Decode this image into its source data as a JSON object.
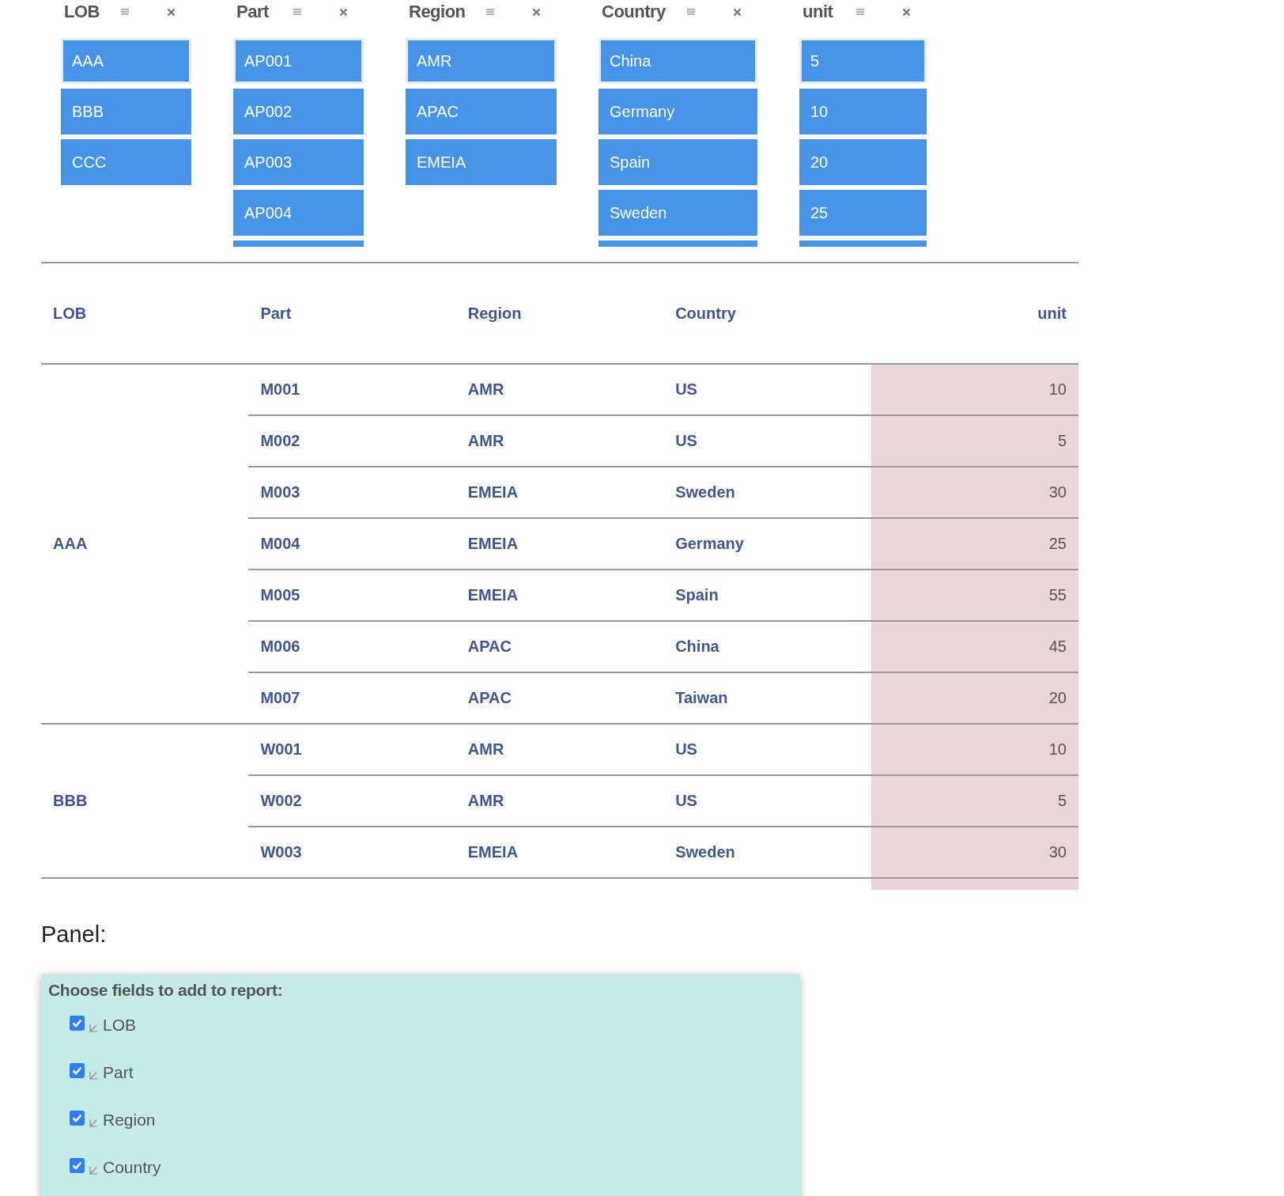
{
  "slicers": [
    {
      "title": "LOB",
      "items": [
        {
          "label": "AAA",
          "selected": true
        },
        {
          "label": "BBB",
          "selected": true
        },
        {
          "label": "CCC",
          "selected": true
        }
      ]
    },
    {
      "title": "Part",
      "more_below": true,
      "items": [
        {
          "label": "AP001",
          "selected": true
        },
        {
          "label": "AP002",
          "selected": true
        },
        {
          "label": "AP003",
          "selected": true
        },
        {
          "label": "AP004",
          "selected": true
        }
      ]
    },
    {
      "title": "Region",
      "items": [
        {
          "label": "AMR",
          "selected": true
        },
        {
          "label": "APAC",
          "selected": true
        },
        {
          "label": "EMEIA",
          "selected": true
        }
      ]
    },
    {
      "title": "Country",
      "more_below": true,
      "items": [
        {
          "label": "China",
          "selected": true
        },
        {
          "label": "Germany",
          "selected": true
        },
        {
          "label": "Spain",
          "selected": true
        },
        {
          "label": "Sweden",
          "selected": true
        }
      ]
    },
    {
      "title": "unit",
      "more_below": true,
      "items": [
        {
          "label": "5",
          "selected": true
        },
        {
          "label": "10",
          "selected": true
        },
        {
          "label": "20",
          "selected": true
        },
        {
          "label": "25",
          "selected": true
        }
      ]
    }
  ],
  "table": {
    "columns": [
      "LOB",
      "Part",
      "Region",
      "Country",
      "unit"
    ],
    "groups": [
      {
        "lob": "AAA",
        "rows": [
          {
            "part": "M001",
            "region": "AMR",
            "country": "US",
            "unit": "10"
          },
          {
            "part": "M002",
            "region": "AMR",
            "country": "US",
            "unit": "5"
          },
          {
            "part": "M003",
            "region": "EMEIA",
            "country": "Sweden",
            "unit": "30"
          },
          {
            "part": "M004",
            "region": "EMEIA",
            "country": "Germany",
            "unit": "25"
          },
          {
            "part": "M005",
            "region": "EMEIA",
            "country": "Spain",
            "unit": "55"
          },
          {
            "part": "M006",
            "region": "APAC",
            "country": "China",
            "unit": "45"
          },
          {
            "part": "M007",
            "region": "APAC",
            "country": "Taiwan",
            "unit": "20"
          }
        ]
      },
      {
        "lob": "BBB",
        "rows": [
          {
            "part": "W001",
            "region": "AMR",
            "country": "US",
            "unit": "10"
          },
          {
            "part": "W002",
            "region": "AMR",
            "country": "US",
            "unit": "5"
          },
          {
            "part": "W003",
            "region": "EMEIA",
            "country": "Sweden",
            "unit": "30"
          }
        ]
      }
    ]
  },
  "panel": {
    "heading": "Panel:",
    "title": "Choose fields to add to report:",
    "fields": [
      {
        "label": "LOB",
        "checked": true
      },
      {
        "label": "Part",
        "checked": true
      },
      {
        "label": "Region",
        "checked": true
      },
      {
        "label": "Country",
        "checked": true
      }
    ]
  }
}
